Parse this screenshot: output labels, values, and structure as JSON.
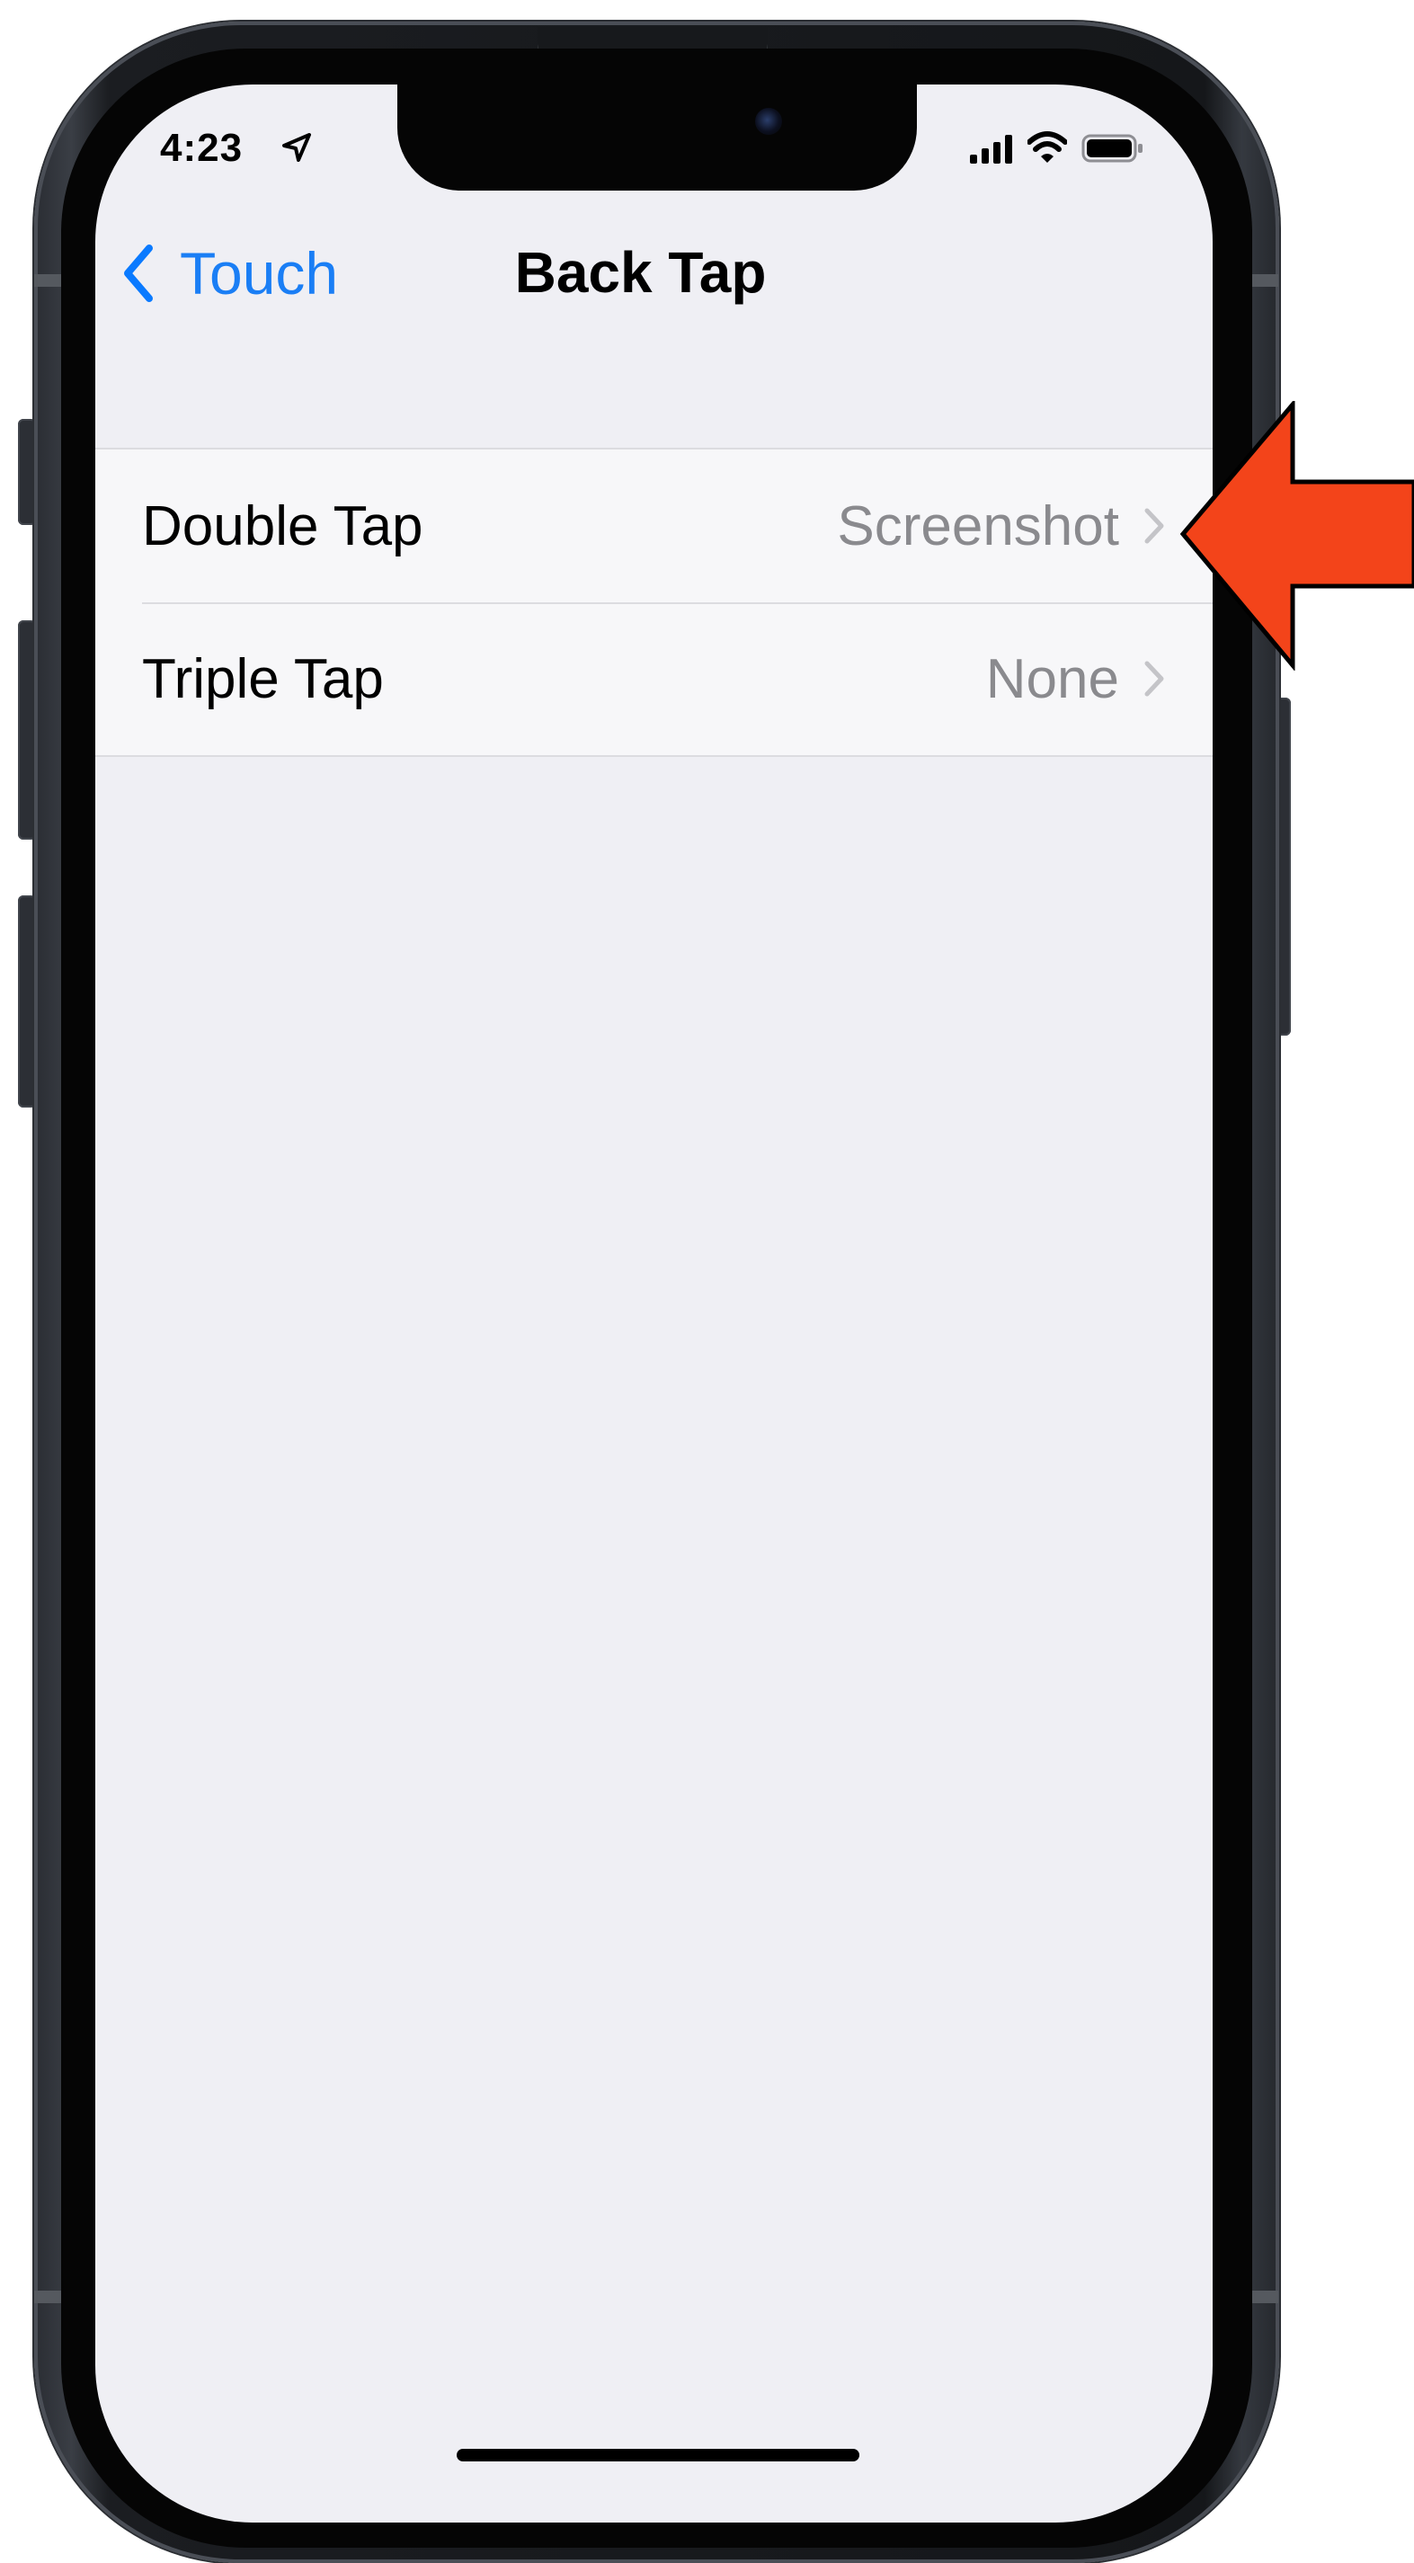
{
  "status_bar": {
    "time": "4:23",
    "icons": [
      "location-icon",
      "signal-icon",
      "wifi-icon",
      "battery-icon"
    ]
  },
  "nav": {
    "back_label": "Touch",
    "title": "Back Tap"
  },
  "rows": [
    {
      "label": "Double Tap",
      "value": "Screenshot"
    },
    {
      "label": "Triple Tap",
      "value": "None"
    }
  ],
  "colors": {
    "accent": "#0a7aff",
    "background": "#efeff4",
    "row_background": "#f7f7f9",
    "secondary_text": "#8a8a8e",
    "callout_arrow": "#f3441a"
  }
}
